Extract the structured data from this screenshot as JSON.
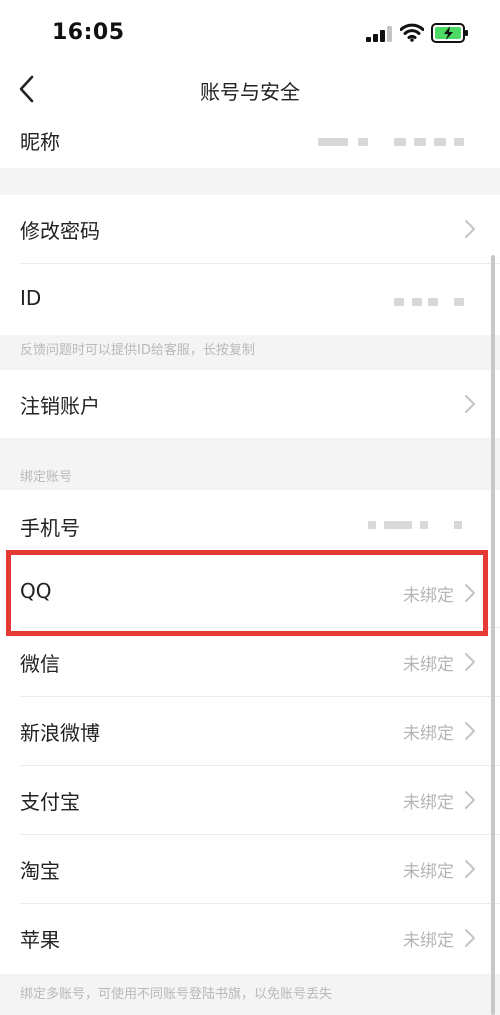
{
  "status": {
    "time": "16:05"
  },
  "nav": {
    "title": "账号与安全"
  },
  "profile": {
    "nickname_label": "昵称"
  },
  "security": {
    "change_password": "修改密码",
    "id_label": "ID",
    "id_hint": "反馈问题时可以提供ID给客服，长按复制",
    "cancel_account": "注销账户"
  },
  "bind": {
    "section_title": "绑定账号",
    "phone_label": "手机号",
    "items": [
      {
        "label": "QQ",
        "status": "未绑定"
      },
      {
        "label": "微信",
        "status": "未绑定"
      },
      {
        "label": "新浪微博",
        "status": "未绑定"
      },
      {
        "label": "支付宝",
        "status": "未绑定"
      },
      {
        "label": "淘宝",
        "status": "未绑定"
      },
      {
        "label": "苹果",
        "status": "未绑定"
      }
    ],
    "footer_hint": "绑定多账号，可使用不同账号登陆书旗，以免账号丢失"
  },
  "colors": {
    "highlight": "#e53935",
    "battery": "#4cd964"
  }
}
